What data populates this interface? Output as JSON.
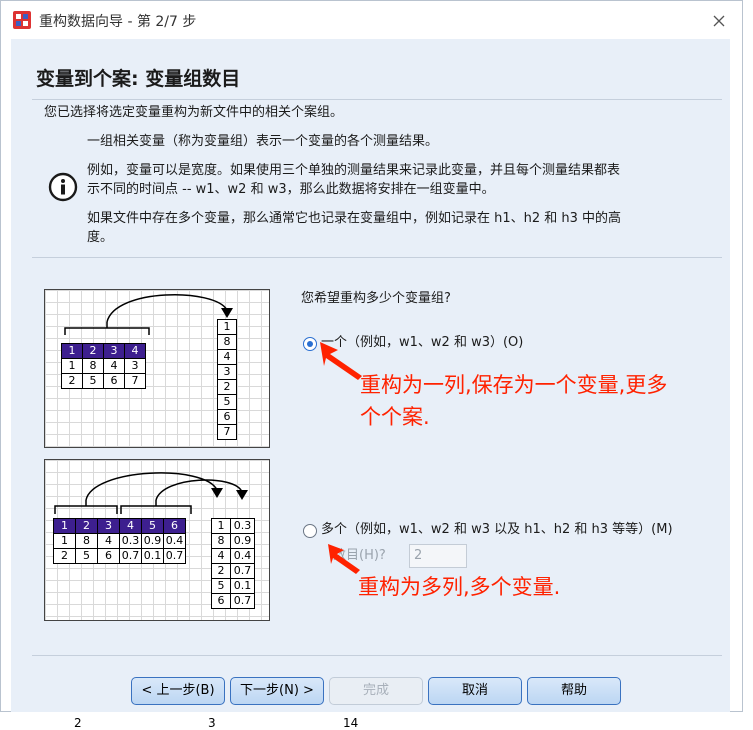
{
  "window": {
    "title": "重构数据向导 - 第 2/7 步"
  },
  "page": {
    "heading": "变量到个案: 变量组数目",
    "intro": "您已选择将选定变量重构为新文件中的相关个案组。",
    "info1": "一组相关变量（称为变量组）表示一个变量的各个测量结果。",
    "info2_line1": "例如，变量可以是宽度。如果使用三个单独的测量结果来记录此变量，并且每个测量结果都表",
    "info2_line2": "示不同的时间点 -- w1、w2 和 w3，那么此数据将安排在一组变量中。",
    "info3_line1": "如果文件中存在多个变量，那么通常它也记录在变量组中，例如记录在 h1、h2 和 h3 中的高",
    "info3_line2": "度。"
  },
  "question": "您希望重构多少个变量组?",
  "options": {
    "one": {
      "label": "一个（例如，w1、w2 和 w3）(O)",
      "selected": true
    },
    "many": {
      "label": "多个（例如，w1、w2 和 w3 以及 h1、h2 和 h3 等等）(M)",
      "selected": false
    },
    "count_label": "数目(H)?",
    "count_value": "2"
  },
  "annotations": {
    "one_line1": "重构为一列,保存为一个变量,更多",
    "one_line2": "个个案.",
    "many": "重构为多列,多个变量."
  },
  "figure1": {
    "header": [
      "1",
      "2",
      "3",
      "4"
    ],
    "rows": [
      [
        "1",
        "8",
        "4",
        "3"
      ],
      [
        "2",
        "5",
        "6",
        "7"
      ]
    ],
    "column": [
      "1",
      "8",
      "4",
      "3",
      "2",
      "5",
      "6",
      "7"
    ]
  },
  "figure2": {
    "header": [
      "1",
      "2",
      "3",
      "4",
      "5",
      "6"
    ],
    "rows": [
      [
        "1",
        "8",
        "4",
        "0.3",
        "0.9",
        "0.4"
      ],
      [
        "2",
        "5",
        "6",
        "0.7",
        "0.1",
        "0.7"
      ]
    ],
    "col_a": [
      "1",
      "8",
      "4",
      "2",
      "5",
      "6"
    ],
    "col_b": [
      "0.3",
      "0.9",
      "0.4",
      "0.7",
      "0.1",
      "0.7"
    ]
  },
  "buttons": {
    "back": "< 上一步(B)",
    "next": "下一步(N) >",
    "finish": "完成",
    "cancel": "取消",
    "help": "帮助"
  },
  "background_cells": [
    "2",
    "3",
    "14"
  ],
  "colors": {
    "accent": "#2a6fd1",
    "header_fill": "#3d1f8f",
    "annotation": "#ff2200",
    "panel": "#e8eff8"
  }
}
